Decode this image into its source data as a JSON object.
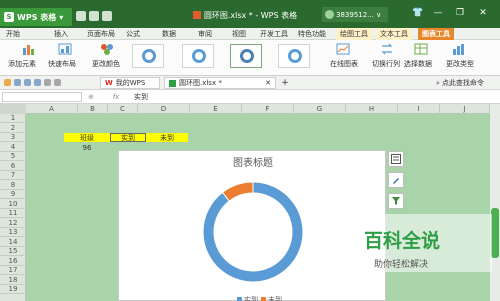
{
  "window": {
    "app_name": "WPS 表格",
    "doc_title": "圆环图.xlsx * - WPS 表格",
    "user": "3839512... ∨"
  },
  "menu_tabs": [
    "开始",
    "插入",
    "页面布局",
    "公式",
    "数据",
    "审阅",
    "视图",
    "开发工具",
    "特色功能",
    "绘图工具",
    "文本工具",
    "图表工具"
  ],
  "ribbon": {
    "add_element": "添加元素",
    "quick_layout": "快速布局",
    "change_color": "更改颜色",
    "online_chart": "在线图表",
    "switch_row_col": "切换行列",
    "select_data": "选择数据",
    "change_type": "更改类型"
  },
  "tab_row": {
    "my_wps": "我的WPS",
    "file_tab": "圆环图.xlsx *",
    "add": "+",
    "hint": "点此查找命令"
  },
  "formula_bar": {
    "fx": "fx",
    "content": "实到"
  },
  "sheet": {
    "columns": [
      "A",
      "B",
      "C",
      "D",
      "E",
      "F",
      "G",
      "H",
      "I",
      "J"
    ],
    "rows": [
      "1",
      "2",
      "3",
      "4",
      "5",
      "6",
      "7",
      "8",
      "9",
      "10",
      "11",
      "12",
      "13",
      "14",
      "15",
      "16",
      "17",
      "18",
      "19",
      "20"
    ],
    "cells": {
      "b3": "班级",
      "c3": "实到",
      "d3": "未到",
      "b4": "96"
    }
  },
  "chart_data": {
    "type": "pie",
    "title": "图表标题",
    "slices": [
      {
        "label": "实到",
        "value": 86,
        "color": "#5b9bd5"
      },
      {
        "label": "未到",
        "value": 10,
        "color": "#ed7d31"
      }
    ],
    "legend": "bottom"
  },
  "watermark": {
    "title": "百科全说",
    "subtitle": "助你轻松解决"
  }
}
